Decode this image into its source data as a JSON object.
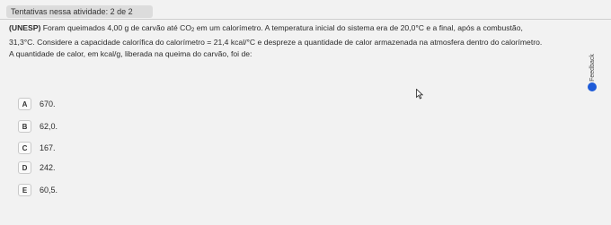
{
  "header": {
    "attempts": "Tentativas nessa atividade: 2 de 2"
  },
  "question": {
    "source": "(UNESP)",
    "line1_a": " Foram queimados 4,00 g de carvão até CO",
    "line1_sub": "2",
    "line1_b": " em um calorímetro. A temperatura inicial do sistema era de 20,0°C e a final, após a combustão,",
    "line2": "31,3°C. Considere a capacidade calorífica do calorímetro = 21,4 kcal/°C e despreze a quantidade de calor armazenada na atmosfera dentro do calorímetro.",
    "line3": "A quantidade de calor, em kcal/g, liberada na queima do carvão, foi de:"
  },
  "options": [
    {
      "letter": "A",
      "text": "670."
    },
    {
      "letter": "B",
      "text": "62,0."
    },
    {
      "letter": "C",
      "text": "167."
    },
    {
      "letter": "D",
      "text": "242."
    },
    {
      "letter": "E",
      "text": "60,5."
    }
  ],
  "feedback": {
    "label": "Feedback",
    "icon": "feedback-icon",
    "accent": "#1e5bd8"
  }
}
